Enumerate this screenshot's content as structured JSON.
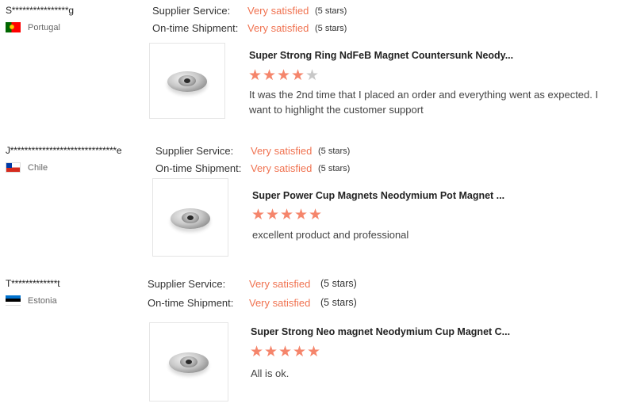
{
  "reviews": [
    {
      "reviewer": "S****************g",
      "country": "Portugal",
      "flag": "portugal-flag",
      "supplier_service_label": "Supplier Service:",
      "supplier_service_value": "Very satisfied",
      "supplier_service_stars": "(5 stars)",
      "shipment_label": "On-time Shipment:",
      "shipment_value": "Very satisfied",
      "shipment_stars": "(5 stars)",
      "product_title": "Super Strong Ring NdFeB Magnet Countersunk Neody...",
      "product_rating": 4,
      "product_rating_max": 5,
      "comment": "It was the 2nd time that I placed an order and everything went as expected. I want to highlight the customer support"
    },
    {
      "reviewer": "J******************************e",
      "country": "Chile",
      "flag": "chile-flag",
      "supplier_service_label": "Supplier Service:",
      "supplier_service_value": "Very satisfied",
      "supplier_service_stars": "(5 stars)",
      "shipment_label": "On-time Shipment:",
      "shipment_value": "Very satisfied",
      "shipment_stars": "(5 stars)",
      "product_title": "Super Power Cup Magnets Neodymium Pot Magnet ...",
      "product_rating": 5,
      "product_rating_max": 5,
      "comment": "excellent product and professional"
    },
    {
      "reviewer": "T*************t",
      "country": "Estonia",
      "flag": "estonia-flag",
      "supplier_service_label": "Supplier Service:",
      "supplier_service_value": "Very satisfied",
      "supplier_service_stars": "(5 stars)",
      "shipment_label": "On-time Shipment:",
      "shipment_value": "Very satisfied",
      "shipment_stars": "(5 stars)",
      "product_title": "Super Strong Neo magnet Neodymium Cup Magnet C...",
      "product_rating": 5,
      "product_rating_max": 5,
      "comment": "All is ok."
    }
  ],
  "colors": {
    "accent": "#f07250",
    "star_filled": "#f5856b",
    "star_empty": "#c8c8c8"
  }
}
